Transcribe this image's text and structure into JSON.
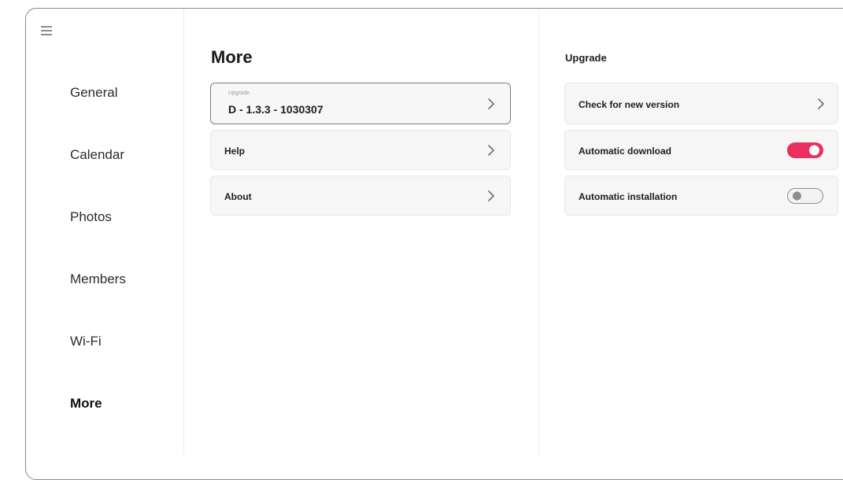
{
  "sidebar": {
    "menu_icon": "hamburger-menu-icon",
    "items": [
      {
        "label": "General"
      },
      {
        "label": "Calendar"
      },
      {
        "label": "Photos"
      },
      {
        "label": "Members"
      },
      {
        "label": "Wi-Fi"
      },
      {
        "label": "More",
        "active": true
      }
    ]
  },
  "main": {
    "title": "More",
    "rows": [
      {
        "sublabel": "Upgrade",
        "value": "D - 1.3.3 - 1030307",
        "icon": "chevron-right-icon"
      },
      {
        "label": "Help",
        "icon": "chevron-right-icon"
      },
      {
        "label": "About",
        "icon": "chevron-right-icon"
      }
    ]
  },
  "detail": {
    "title": "Upgrade",
    "rows": [
      {
        "label": "Check for new version",
        "control": "chevron-right-icon"
      },
      {
        "label": "Automatic download",
        "control": "toggle",
        "enabled": true
      },
      {
        "label": "Automatic installation",
        "control": "toggle",
        "enabled": false
      }
    ],
    "accent_color": "#ea2f5c"
  }
}
